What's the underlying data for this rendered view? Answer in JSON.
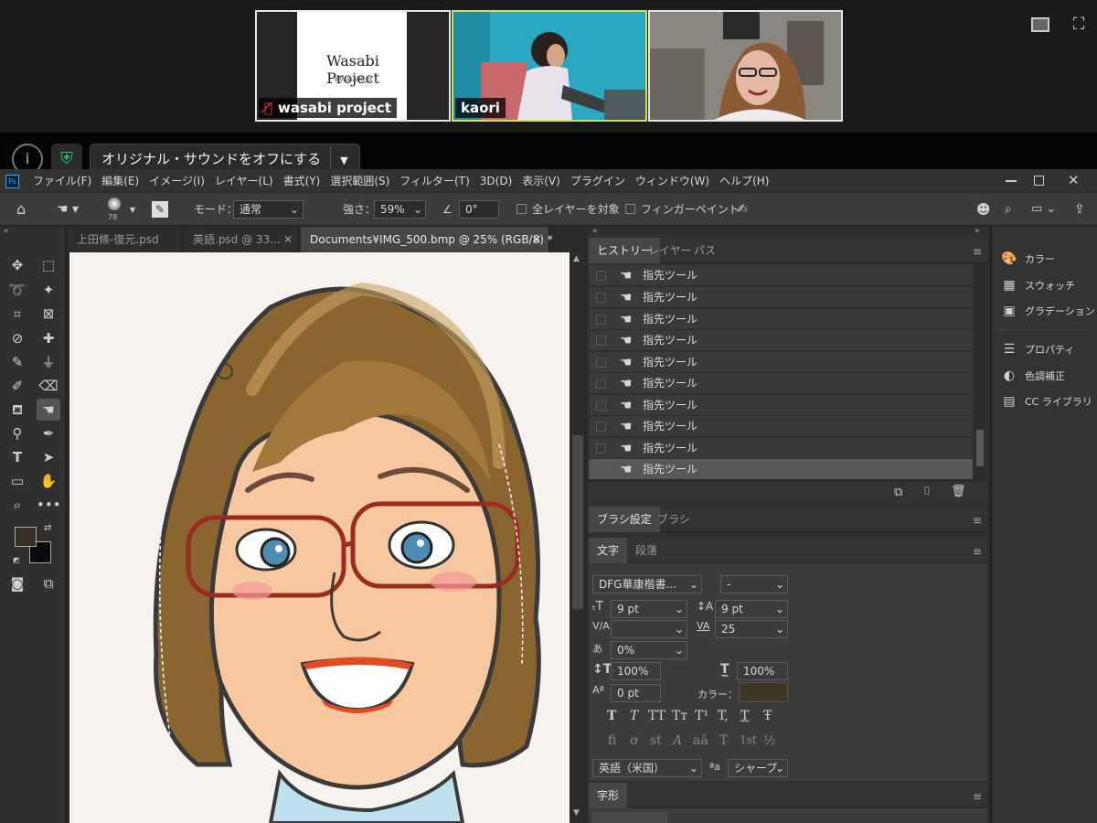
{
  "zoom": {
    "participants": [
      {
        "name": "wasabi project",
        "title_logo": "Wasabi Project",
        "subtitle_logo": "#Wasabi_jp",
        "muted": true
      },
      {
        "name": "kaori",
        "muted": false
      },
      {
        "name": "",
        "muted": false
      }
    ],
    "info_icon": "info-icon",
    "shield_icon": "shield-icon",
    "sound_button_label": "オリジナル・サウンドをオフにする",
    "dropdown_icon": "caret-down-icon"
  },
  "menubar": {
    "app_icon_label": "Ps",
    "items": [
      "ファイル(F)",
      "編集(E)",
      "イメージ(I)",
      "レイヤー(L)",
      "書式(Y)",
      "選択範囲(S)",
      "フィルター(T)",
      "3D(D)",
      "表示(V)",
      "プラグイン",
      "ウィンドウ(W)",
      "ヘルプ(H)"
    ]
  },
  "options": {
    "brush_size": "78",
    "mode_label": "モード：",
    "mode_value": "通常",
    "strength_label": "強さ：",
    "strength_value": "59%",
    "angle_value": "0°",
    "all_layers_label": "全レイヤーを対象",
    "finger_paint_label": "フィンガーペイント"
  },
  "document_tabs": [
    {
      "label": "上田條-復元.psd",
      "active": false
    },
    {
      "label": "英語.psd @ 33...",
      "active": false
    },
    {
      "label": "Documents¥IMG_500.bmp @ 25% (RGB/8) *",
      "active": true
    }
  ],
  "history": {
    "tabs": [
      "ヒストリー",
      "レイヤー",
      "パス"
    ],
    "items": [
      "指先ツール",
      "指先ツール",
      "指先ツール",
      "指先ツール",
      "指先ツール",
      "指先ツール",
      "指先ツール",
      "指先ツール",
      "指先ツール",
      "指先ツール"
    ],
    "selected_index": 9
  },
  "brush_panel": {
    "tabs": [
      "ブラシ設定",
      "ブラシ"
    ]
  },
  "character_panel": {
    "tabs": [
      "文字",
      "段落"
    ],
    "font_family": "DFG華康楷書...",
    "font_style": "-",
    "font_size": "9 pt",
    "leading": "9 pt",
    "kerning": "",
    "tracking": "25",
    "tsume": "0%",
    "vertical_scale": "100%",
    "horizontal_scale": "100%",
    "baseline_shift": "0 pt",
    "color_label": "カラー：",
    "color_swatch": "#3d3724",
    "language": "英語（米国）",
    "aa_label": "ªa",
    "antialias": "シャープ",
    "style_glyphs": [
      "T",
      "T",
      "TT",
      "Tт",
      "T¹",
      "T,",
      "T",
      "Ŧ"
    ],
    "opentype_glyphs": [
      "fi",
      "ơ",
      "st",
      "A",
      "aā",
      "T",
      "1st",
      "½"
    ]
  },
  "glyph_panel": {
    "tab": "字形"
  },
  "right_panels": [
    {
      "label": "カラー",
      "icon": "palette-icon"
    },
    {
      "label": "スウォッチ",
      "icon": "grid-icon"
    },
    {
      "label": "グラデーション",
      "icon": "gradient-icon"
    },
    {
      "label": "プロパティ",
      "icon": "sliders-icon"
    },
    {
      "label": "色調補正",
      "icon": "adjustment-icon"
    },
    {
      "label": "CC ライブラリ",
      "icon": "library-icon"
    }
  ],
  "colors": {
    "foreground": "#3a2f20",
    "background": "#0c0c0c",
    "accent": "#31a8ff"
  }
}
